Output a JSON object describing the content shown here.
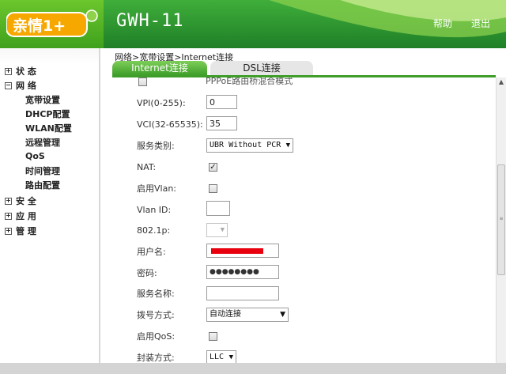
{
  "header": {
    "logo_text": "亲情1+",
    "device_title": "GWH-11",
    "help_label": "帮助",
    "logout_label": "退出",
    "colors": {
      "brand_green": "#3fae3a",
      "dark_green": "#1f7f27",
      "logo_orange": "#f6a800"
    }
  },
  "sidebar": {
    "top_items": [
      {
        "label": "状  态",
        "expand_glyph": "+"
      },
      {
        "label": "网  络",
        "expand_glyph": "−"
      },
      {
        "label": "安  全",
        "expand_glyph": "+"
      },
      {
        "label": "应  用",
        "expand_glyph": "+"
      },
      {
        "label": "管  理",
        "expand_glyph": "+"
      }
    ],
    "network_subitems": [
      {
        "label": "宽带设置"
      },
      {
        "label": "DHCP配置"
      },
      {
        "label": "WLAN配置"
      },
      {
        "label": "远程管理"
      },
      {
        "label": "QoS"
      },
      {
        "label": "时间管理"
      },
      {
        "label": "路由配置"
      }
    ]
  },
  "main": {
    "breadcrumb": "网络>宽带设置>Internet连接",
    "tabs": [
      {
        "label": "Internet连接",
        "active": true
      },
      {
        "label": "DSL连接",
        "active": false
      }
    ],
    "form": {
      "pppoe_bridge_label": "PPPoE路由桥混合模式",
      "vpi": {
        "label": "VPI(0-255):",
        "value": "0"
      },
      "vci": {
        "label": "VCI(32-65535):",
        "value": "35"
      },
      "service_type": {
        "label": "服务类别:",
        "selected": "UBR Without PCR"
      },
      "nat": {
        "label": "NAT:",
        "checked_glyph": "✓"
      },
      "enable_vlan": {
        "label": "启用Vlan:"
      },
      "vlan_id": {
        "label": "Vlan ID:",
        "value": ""
      },
      "dot1p": {
        "label": "802.1p:",
        "selected": ""
      },
      "username": {
        "label": "用户名:"
      },
      "password": {
        "label": "密码:",
        "value": "●●●●●●●●"
      },
      "service_name": {
        "label": "服务名称:",
        "value": ""
      },
      "dial_mode": {
        "label": "拨号方式:",
        "selected": "自动连接"
      },
      "enable_qos": {
        "label": "启用QoS:"
      },
      "encapsulation": {
        "label": "封装方式:",
        "selected": "LLC"
      }
    }
  }
}
